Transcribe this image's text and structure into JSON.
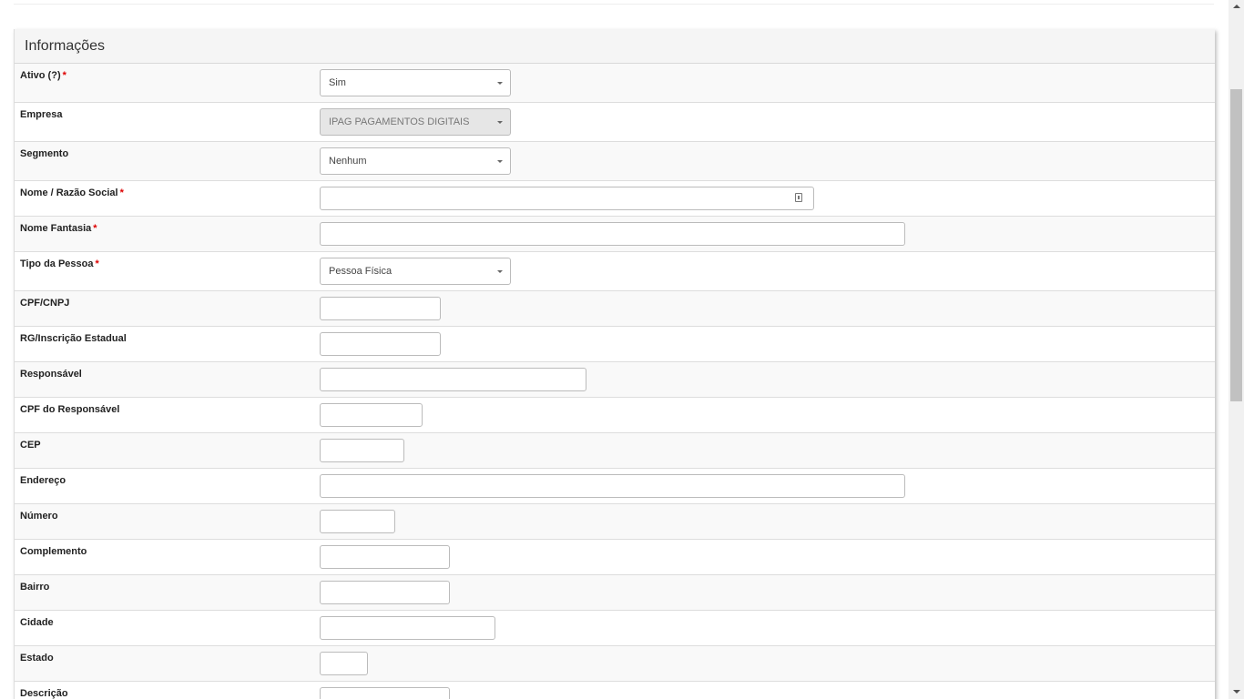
{
  "panel": {
    "title": "Informações"
  },
  "fields": [
    {
      "key": "ativo",
      "label": "Ativo (?)",
      "required": true,
      "control": "select",
      "value": "Sim"
    },
    {
      "key": "empresa",
      "label": "Empresa",
      "required": false,
      "control": "select",
      "value": "IPAG PAGAMENTOS DIGITAIS",
      "disabled": true
    },
    {
      "key": "segmento",
      "label": "Segmento",
      "required": false,
      "control": "select",
      "value": "Nenhum"
    },
    {
      "key": "nome_razao_social",
      "label": "Nome / Razão Social",
      "required": true,
      "control": "text",
      "value": "",
      "icon": "contact-card-icon"
    },
    {
      "key": "nome_fantasia",
      "label": "Nome Fantasia",
      "required": true,
      "control": "text",
      "value": ""
    },
    {
      "key": "tipo_pessoa",
      "label": "Tipo da Pessoa",
      "required": true,
      "control": "select",
      "value": "Pessoa Física"
    },
    {
      "key": "cpf_cnpj",
      "label": "CPF/CNPJ",
      "required": false,
      "control": "text",
      "value": ""
    },
    {
      "key": "rg_ie",
      "label": "RG/Inscrição Estadual",
      "required": false,
      "control": "text",
      "value": ""
    },
    {
      "key": "responsavel",
      "label": "Responsável",
      "required": false,
      "control": "text",
      "value": ""
    },
    {
      "key": "cpf_responsavel",
      "label": "CPF do Responsável",
      "required": false,
      "control": "text",
      "value": ""
    },
    {
      "key": "cep",
      "label": "CEP",
      "required": false,
      "control": "text",
      "value": ""
    },
    {
      "key": "endereco",
      "label": "Endereço",
      "required": false,
      "control": "text",
      "value": ""
    },
    {
      "key": "numero",
      "label": "Número",
      "required": false,
      "control": "text",
      "value": ""
    },
    {
      "key": "complemento",
      "label": "Complemento",
      "required": false,
      "control": "text",
      "value": ""
    },
    {
      "key": "bairro",
      "label": "Bairro",
      "required": false,
      "control": "text",
      "value": ""
    },
    {
      "key": "cidade",
      "label": "Cidade",
      "required": false,
      "control": "text",
      "value": ""
    },
    {
      "key": "estado",
      "label": "Estado",
      "required": false,
      "control": "text",
      "value": ""
    },
    {
      "key": "descricao",
      "label": "Descrição",
      "required": false,
      "control": "text",
      "value": ""
    }
  ],
  "colors": {
    "required_marker": "#dd0000",
    "row_alt": "#f9f9f9",
    "border": "#dddddd"
  }
}
